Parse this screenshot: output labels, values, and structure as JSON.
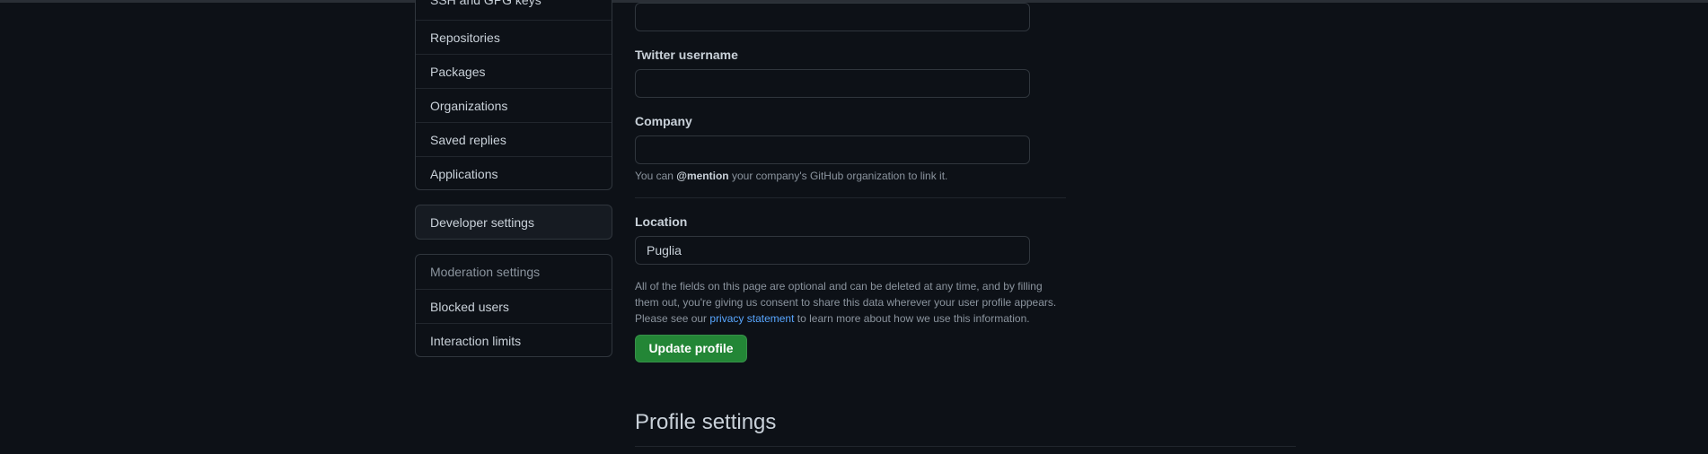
{
  "sidebar": {
    "primary_items": [
      {
        "label": "SSH and GPG keys"
      },
      {
        "label": "Repositories"
      },
      {
        "label": "Packages"
      },
      {
        "label": "Organizations"
      },
      {
        "label": "Saved replies"
      },
      {
        "label": "Applications"
      }
    ],
    "developer_settings": "Developer settings",
    "moderation": {
      "heading": "Moderation settings",
      "items": [
        {
          "label": "Blocked users"
        },
        {
          "label": "Interaction limits"
        }
      ]
    }
  },
  "form": {
    "top_field": {
      "value": ""
    },
    "twitter": {
      "label": "Twitter username",
      "value": ""
    },
    "company": {
      "label": "Company",
      "value": "",
      "hint_prefix": "You can ",
      "hint_mention": "@mention",
      "hint_suffix": " your company's GitHub organization to link it."
    },
    "location": {
      "label": "Location",
      "value": "Puglia"
    },
    "disclaimer": {
      "text": "All of the fields on this page are optional and can be deleted at any time, and by filling them out, you're giving us consent to share this data wherever your user profile appears. Please see our ",
      "link": "privacy statement",
      "suffix": " to learn more about how we use this information."
    },
    "submit_label": "Update profile"
  },
  "profile_section": {
    "title": "Profile settings"
  }
}
